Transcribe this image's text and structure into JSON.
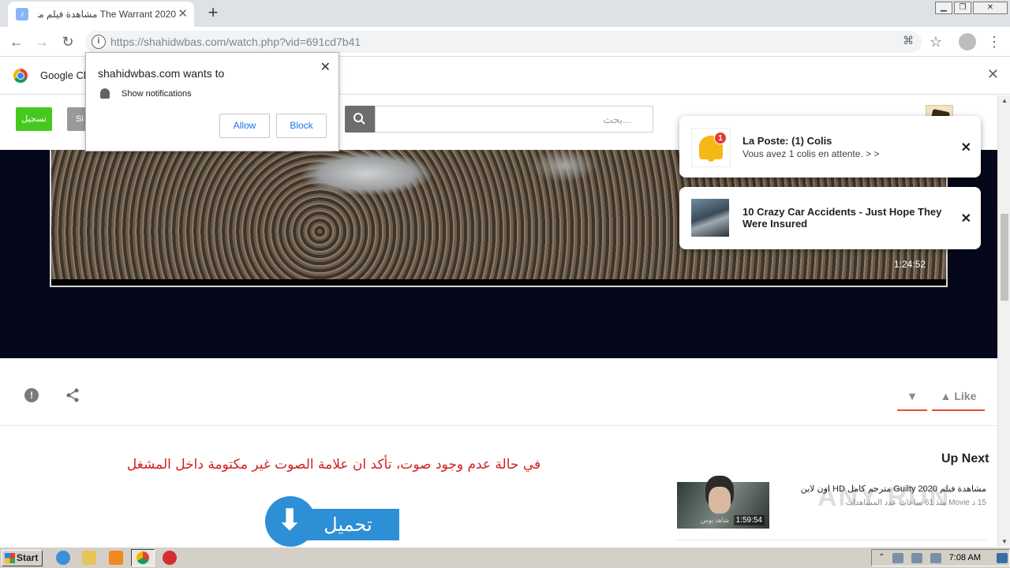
{
  "browser": {
    "tab_title": "The Warrant 2020 مشاهدة فيلم مترجم",
    "tab_favicon": "♪",
    "url_host": "https://shahidwbas.com",
    "url_path": "/watch.php?vid=691cd7b41",
    "infobar_text": "Google Ch"
  },
  "permission_popup": {
    "site": "shahidwbas.com wants to",
    "permission": "Show notifications",
    "allow_label": "Allow",
    "block_label": "Block"
  },
  "site_header": {
    "register_label": "تسجيل",
    "signin_label": "Si",
    "search_placeholder": "بحث..."
  },
  "player": {
    "duration": "1:24:52"
  },
  "actions": {
    "like_label": "Like"
  },
  "content": {
    "sound_warning": "في حالة عدم وجود صوت، تأكد ان علامة الصوت غير مكتومة داخل المشغل",
    "download_label": "تحميل",
    "upnext_heading": "Up Next",
    "upnext_item": {
      "title": "مشاهدة فيلم Guilty 2020 مترجم كامل HD اون لاين",
      "meta": "15 د Movie منذ 61 ساعات عدد المشاهدات",
      "duration": "1:59:54",
      "thumb_caption": "شاهد بوس"
    },
    "watermark": "ANY RUN"
  },
  "notifications": [
    {
      "title": "La Poste: (1) Colis",
      "body": "Vous avez 1 colis en attente. > >",
      "badge": "1",
      "icon": "bell-icon"
    },
    {
      "title": "10 Crazy Car Accidents - Just Hope They Were Insured",
      "body": "",
      "icon": "car-crash-image"
    }
  ],
  "taskbar": {
    "start_label": "Start",
    "clock": "7:08 AM"
  },
  "colors": {
    "register_green": "#46c91f",
    "warning_red": "#d42020",
    "download_blue": "#2d8fd6",
    "like_underline": "#e74c3c",
    "player_bg": "#05081a"
  }
}
